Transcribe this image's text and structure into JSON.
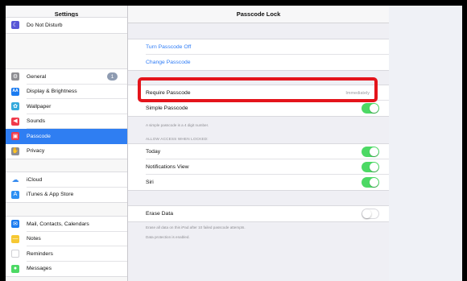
{
  "sidebar": {
    "title": "Settings",
    "groups": [
      {
        "items": [
          {
            "label": "Do Not Disturb",
            "icon": "moon-icon",
            "color": "#5856d6"
          }
        ]
      },
      {
        "items": [
          {
            "label": "General",
            "icon": "gear-icon",
            "color": "#8e8e93",
            "badge": "1"
          },
          {
            "label": "Display & Brightness",
            "icon": "brightness-icon",
            "color": "#1c7cf0"
          },
          {
            "label": "Wallpaper",
            "icon": "wallpaper-icon",
            "color": "#35aadc"
          },
          {
            "label": "Sounds",
            "icon": "speaker-icon",
            "color": "#f03a4b"
          },
          {
            "label": "Passcode",
            "icon": "lock-icon",
            "color": "#f03a4b",
            "selected": true
          },
          {
            "label": "Privacy",
            "icon": "hand-icon",
            "color": "#8e8e93"
          }
        ]
      },
      {
        "items": [
          {
            "label": "iCloud",
            "icon": "cloud-icon",
            "color": "#ffffff"
          },
          {
            "label": "iTunes & App Store",
            "icon": "appstore-icon",
            "color": "#2c8ff3"
          }
        ]
      },
      {
        "items": [
          {
            "label": "Mail, Contacts, Calendars",
            "icon": "mail-icon",
            "color": "#1c7cf0"
          },
          {
            "label": "Notes",
            "icon": "notes-icon",
            "color": "#f6c833"
          },
          {
            "label": "Reminders",
            "icon": "reminders-icon",
            "color": "#ffffff"
          },
          {
            "label": "Messages",
            "icon": "messages-icon",
            "color": "#4cd964"
          }
        ]
      }
    ]
  },
  "detail": {
    "title": "Passcode Lock",
    "turn_off": "Turn Passcode Off",
    "change": "Change Passcode",
    "require_label": "Require Passcode",
    "require_value": "Immediately",
    "simple_label": "Simple Passcode",
    "simple_note": "A simple passcode is a 4 digit number.",
    "allow_header": "ALLOW ACCESS WHEN LOCKED:",
    "allow_items": [
      "Today",
      "Notifications View",
      "Siri"
    ],
    "erase_label": "Erase Data",
    "erase_note_1": "Erase all data on this iPad after 10 failed passcode attempts.",
    "erase_note_2": "Data protection is enabled.",
    "toggles": {
      "simple": true,
      "today": true,
      "notifications": true,
      "siri": true,
      "erase": false
    }
  },
  "colors": {
    "accent": "#2e7cf6",
    "toggle_on": "#4cd964",
    "highlight": "#e4141b",
    "selected_row": "#2f7ef2"
  }
}
